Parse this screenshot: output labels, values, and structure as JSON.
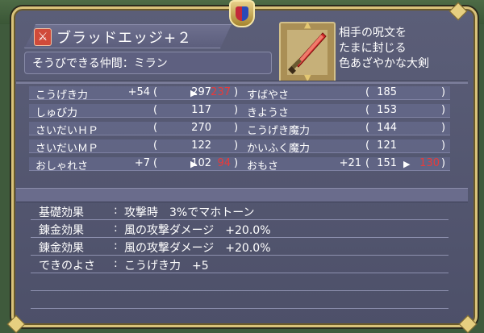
{
  "item": {
    "name": "ブラッドエッジ+２",
    "equip_label": "そうびできる仲間：ミラン",
    "icon": "sword-icon",
    "description": [
      "相手の呪文を",
      "たまに封じる",
      "色あざやかな大剣"
    ]
  },
  "stats_left": [
    {
      "label": "こうげき力",
      "delta": "+54",
      "current": "297",
      "arrow": "▶",
      "new": "237"
    },
    {
      "label": "しゅび力",
      "delta": "",
      "current": "117",
      "arrow": "",
      "new": ""
    },
    {
      "label": "さいだいＨＰ",
      "delta": "",
      "current": "270",
      "arrow": "",
      "new": ""
    },
    {
      "label": "さいだいＭＰ",
      "delta": "",
      "current": "122",
      "arrow": "",
      "new": ""
    },
    {
      "label": "おしゃれさ",
      "delta": "+7",
      "current": "102",
      "arrow": "▶",
      "new": "94"
    }
  ],
  "stats_right": [
    {
      "label": "すばやさ",
      "delta": "",
      "current": "185",
      "arrow": "",
      "new": ""
    },
    {
      "label": "きようさ",
      "delta": "",
      "current": "153",
      "arrow": "",
      "new": ""
    },
    {
      "label": "こうげき魔力",
      "delta": "",
      "current": "144",
      "arrow": "",
      "new": ""
    },
    {
      "label": "かいふく魔力",
      "delta": "",
      "current": "121",
      "arrow": "",
      "new": ""
    },
    {
      "label": "おもさ",
      "delta": "+21",
      "current": "151",
      "arrow": "▶",
      "new": "130"
    }
  ],
  "effects": [
    {
      "label": "基礎効果",
      "value": "攻撃時　3%でマホトーン"
    },
    {
      "label": "錬金効果",
      "value": "風の攻撃ダメージ　+20.0%"
    },
    {
      "label": "錬金効果",
      "value": "風の攻撃ダメージ　+20.0%"
    },
    {
      "label": "できのよさ",
      "value": "こうげき力　+5"
    },
    {
      "label": "",
      "value": ""
    },
    {
      "label": "",
      "value": ""
    }
  ],
  "colors": {
    "frame": "#d9c27a",
    "panel": "#555872",
    "decrease": "#e83a3a"
  }
}
